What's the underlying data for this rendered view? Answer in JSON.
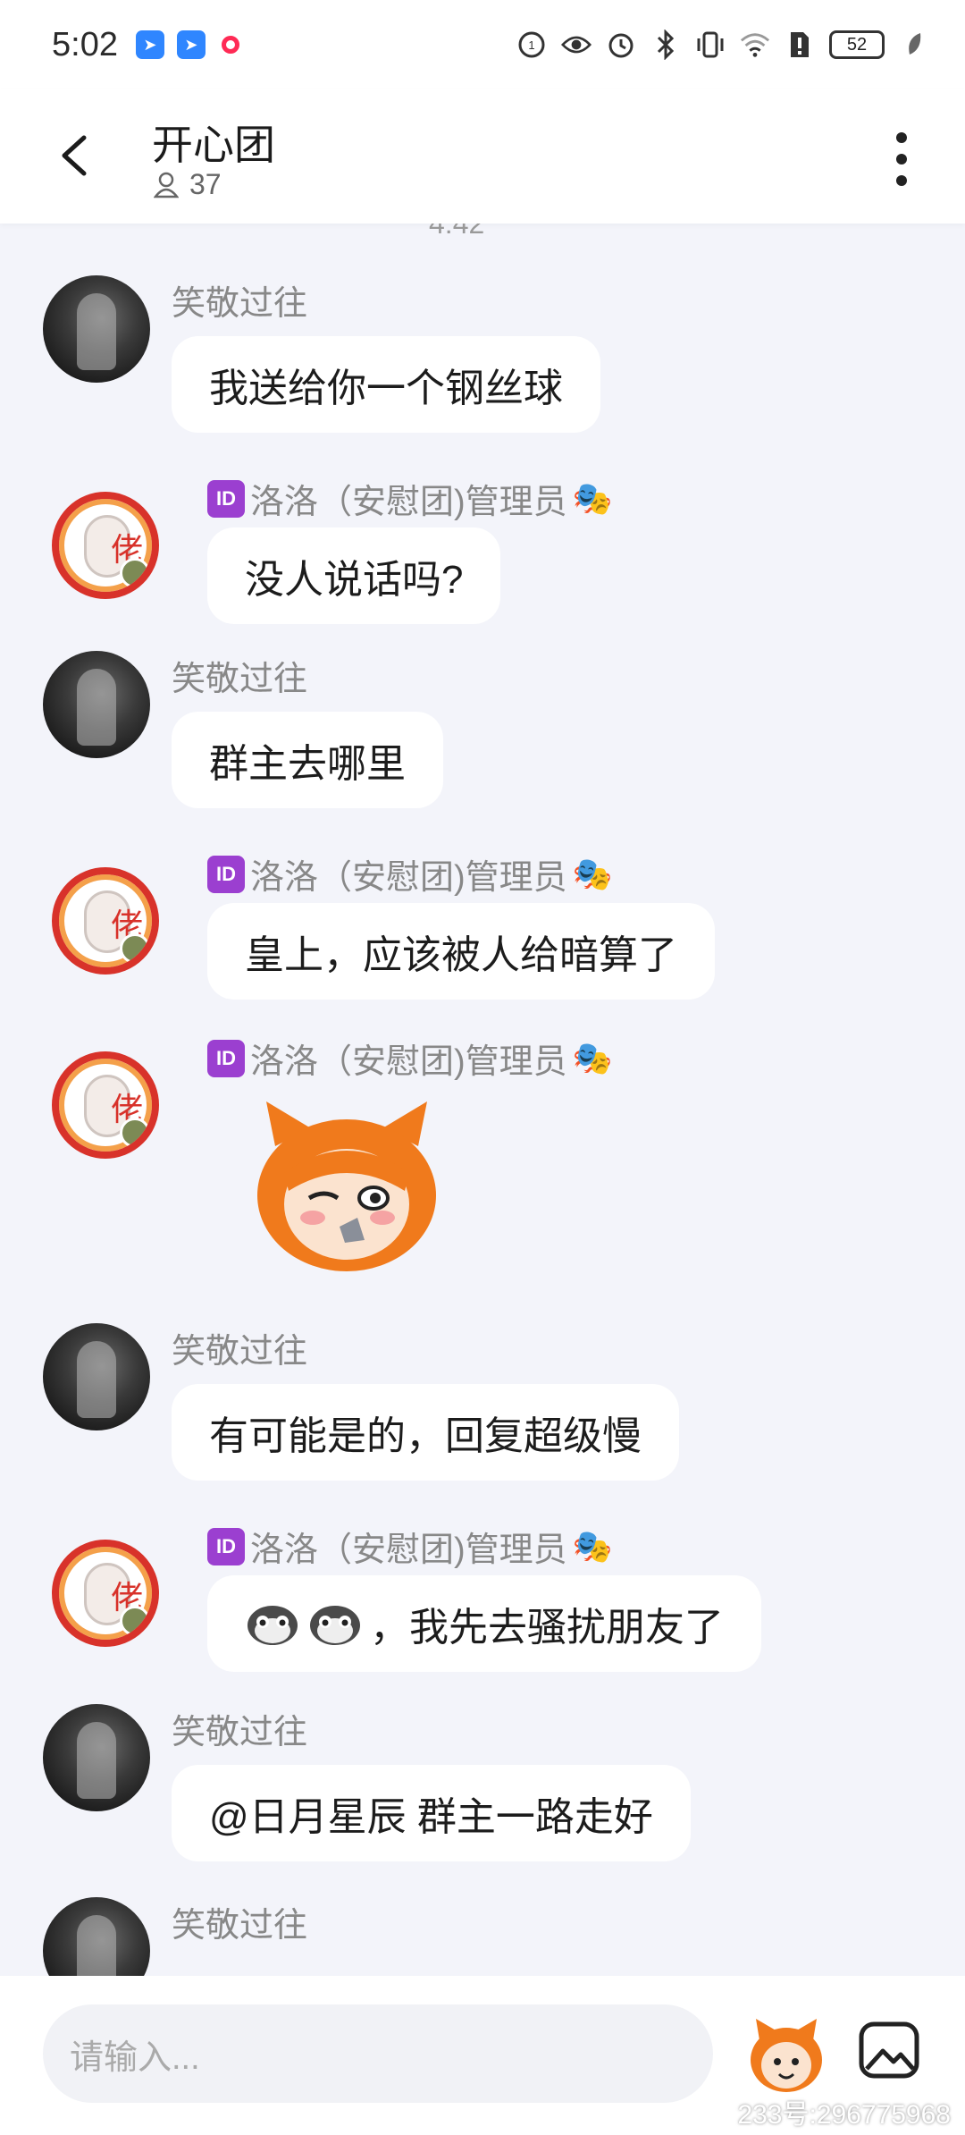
{
  "status_bar": {
    "time": "5:02",
    "battery": "52",
    "icons": [
      "app-icon-blue",
      "app-icon-blue",
      "record-dot-icon",
      "hd-icon",
      "eye-icon",
      "alarm-icon",
      "bluetooth-icon",
      "vibrate-icon",
      "wifi-icon",
      "sim-icon",
      "battery-icon",
      "leaf-icon"
    ]
  },
  "header": {
    "title": "开心团",
    "member_count": "37",
    "icons": [
      "back-arrow-icon",
      "person-icon",
      "more-vertical-icon"
    ]
  },
  "chat": {
    "partial_timestamp": "4:42",
    "messages": [
      {
        "sender": "笑敬过往",
        "text": "我送给你一个钢丝球"
      },
      {
        "sender": "洛洛（安慰团)管理员",
        "text": "没人说话吗?"
      },
      {
        "sender": "笑敬过往",
        "text": "群主去哪里"
      },
      {
        "sender": "洛洛（安慰团)管理员",
        "text": "皇上，应该被人给暗算了"
      },
      {
        "sender": "洛洛（安慰团)管理员",
        "text": ""
      },
      {
        "sender": "笑敬过往",
        "text": "有可能是的，回复超级慢"
      },
      {
        "sender": "洛洛（安慰团)管理员",
        "text": "，我先去骚扰朋友了"
      },
      {
        "sender": "笑敬过往",
        "text": "@日月星辰 群主一路走好"
      },
      {
        "sender": "笑敬过往",
        "text": ""
      }
    ],
    "id_badge": "ID"
  },
  "input_bar": {
    "placeholder": "请输入...",
    "watermark": "233号:296775968"
  },
  "colors": {
    "background": "#f3f4fa",
    "bubble": "#ffffff",
    "id_badge": "#9b3fd0",
    "sender": "#888888"
  }
}
